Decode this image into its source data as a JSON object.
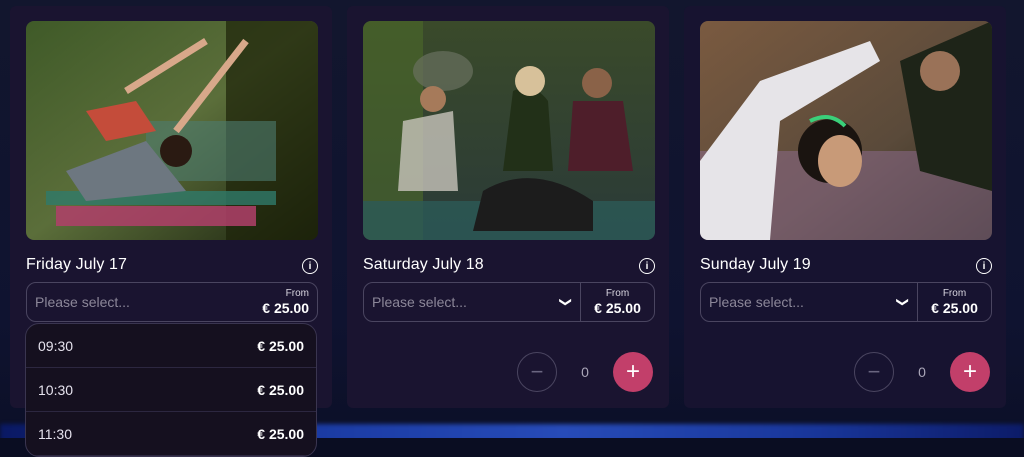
{
  "cards": [
    {
      "date": "Friday July 17",
      "placeholder": "Please select...",
      "from_label": "From",
      "price": "€ 25.00",
      "photo_icon": "yoga-photo-side-stretch"
    },
    {
      "date": "Saturday July 18",
      "placeholder": "Please select...",
      "from_label": "From",
      "price": "€ 25.00",
      "quantity": "0",
      "photo_icon": "yoga-photo-seated-group"
    },
    {
      "date": "Sunday July 19",
      "placeholder": "Please select...",
      "from_label": "From",
      "price": "€ 25.00",
      "quantity": "0",
      "photo_icon": "yoga-photo-side-bend"
    }
  ],
  "dropdown_options": [
    {
      "time": "09:30",
      "price": "€ 25.00"
    },
    {
      "time": "10:30",
      "price": "€ 25.00"
    },
    {
      "time": "11:30",
      "price": "€ 25.00"
    }
  ],
  "colors": {
    "accent_plus": "#c23f6a",
    "card_bg": "#1a1430",
    "page_bg": "#10142b"
  }
}
